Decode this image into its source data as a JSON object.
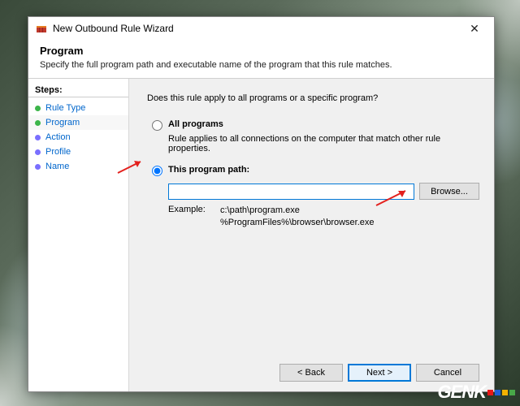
{
  "window": {
    "title": "New Outbound Rule Wizard"
  },
  "header": {
    "title": "Program",
    "subtitle": "Specify the full program path and executable name of the program that this rule matches."
  },
  "sidebar": {
    "heading": "Steps:",
    "items": [
      {
        "label": "Rule Type",
        "link": true,
        "dot": "green"
      },
      {
        "label": "Program",
        "link": true,
        "dot": "green",
        "current": true
      },
      {
        "label": "Action",
        "link": true,
        "dot": "blue"
      },
      {
        "label": "Profile",
        "link": true,
        "dot": "blue"
      },
      {
        "label": "Name",
        "link": true,
        "dot": "blue"
      }
    ]
  },
  "main": {
    "question": "Does this rule apply to all programs or a specific program?",
    "option_all": {
      "label": "All programs",
      "desc": "Rule applies to all connections on the computer that match other rule properties."
    },
    "option_path": {
      "label": "This program path:",
      "value": "",
      "browse": "Browse...",
      "example_label": "Example:",
      "example_lines": "c:\\path\\program.exe\n%ProgramFiles%\\browser\\browser.exe"
    }
  },
  "footer": {
    "back": "< Back",
    "next": "Next >",
    "cancel": "Cancel"
  },
  "logo": {
    "text": "GENK"
  }
}
